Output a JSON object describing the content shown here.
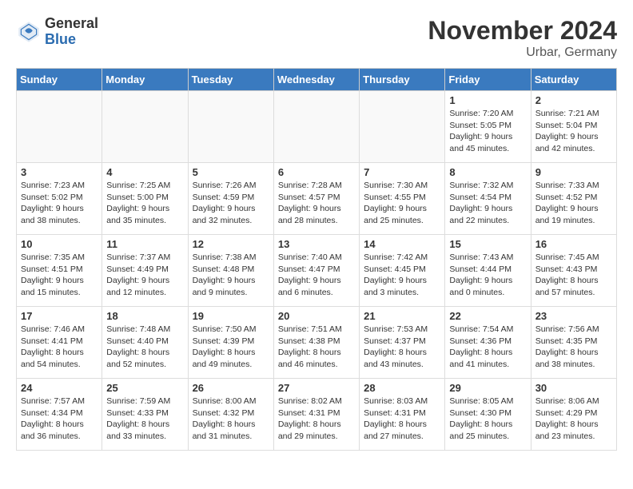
{
  "logo": {
    "general": "General",
    "blue": "Blue"
  },
  "title": "November 2024",
  "location": "Urbar, Germany",
  "days_of_week": [
    "Sunday",
    "Monday",
    "Tuesday",
    "Wednesday",
    "Thursday",
    "Friday",
    "Saturday"
  ],
  "weeks": [
    [
      {
        "day": "",
        "info": "",
        "empty": true
      },
      {
        "day": "",
        "info": "",
        "empty": true
      },
      {
        "day": "",
        "info": "",
        "empty": true
      },
      {
        "day": "",
        "info": "",
        "empty": true
      },
      {
        "day": "",
        "info": "",
        "empty": true
      },
      {
        "day": "1",
        "info": "Sunrise: 7:20 AM\nSunset: 5:05 PM\nDaylight: 9 hours and 45 minutes."
      },
      {
        "day": "2",
        "info": "Sunrise: 7:21 AM\nSunset: 5:04 PM\nDaylight: 9 hours and 42 minutes."
      }
    ],
    [
      {
        "day": "3",
        "info": "Sunrise: 7:23 AM\nSunset: 5:02 PM\nDaylight: 9 hours and 38 minutes."
      },
      {
        "day": "4",
        "info": "Sunrise: 7:25 AM\nSunset: 5:00 PM\nDaylight: 9 hours and 35 minutes."
      },
      {
        "day": "5",
        "info": "Sunrise: 7:26 AM\nSunset: 4:59 PM\nDaylight: 9 hours and 32 minutes."
      },
      {
        "day": "6",
        "info": "Sunrise: 7:28 AM\nSunset: 4:57 PM\nDaylight: 9 hours and 28 minutes."
      },
      {
        "day": "7",
        "info": "Sunrise: 7:30 AM\nSunset: 4:55 PM\nDaylight: 9 hours and 25 minutes."
      },
      {
        "day": "8",
        "info": "Sunrise: 7:32 AM\nSunset: 4:54 PM\nDaylight: 9 hours and 22 minutes."
      },
      {
        "day": "9",
        "info": "Sunrise: 7:33 AM\nSunset: 4:52 PM\nDaylight: 9 hours and 19 minutes."
      }
    ],
    [
      {
        "day": "10",
        "info": "Sunrise: 7:35 AM\nSunset: 4:51 PM\nDaylight: 9 hours and 15 minutes."
      },
      {
        "day": "11",
        "info": "Sunrise: 7:37 AM\nSunset: 4:49 PM\nDaylight: 9 hours and 12 minutes."
      },
      {
        "day": "12",
        "info": "Sunrise: 7:38 AM\nSunset: 4:48 PM\nDaylight: 9 hours and 9 minutes."
      },
      {
        "day": "13",
        "info": "Sunrise: 7:40 AM\nSunset: 4:47 PM\nDaylight: 9 hours and 6 minutes."
      },
      {
        "day": "14",
        "info": "Sunrise: 7:42 AM\nSunset: 4:45 PM\nDaylight: 9 hours and 3 minutes."
      },
      {
        "day": "15",
        "info": "Sunrise: 7:43 AM\nSunset: 4:44 PM\nDaylight: 9 hours and 0 minutes."
      },
      {
        "day": "16",
        "info": "Sunrise: 7:45 AM\nSunset: 4:43 PM\nDaylight: 8 hours and 57 minutes."
      }
    ],
    [
      {
        "day": "17",
        "info": "Sunrise: 7:46 AM\nSunset: 4:41 PM\nDaylight: 8 hours and 54 minutes."
      },
      {
        "day": "18",
        "info": "Sunrise: 7:48 AM\nSunset: 4:40 PM\nDaylight: 8 hours and 52 minutes."
      },
      {
        "day": "19",
        "info": "Sunrise: 7:50 AM\nSunset: 4:39 PM\nDaylight: 8 hours and 49 minutes."
      },
      {
        "day": "20",
        "info": "Sunrise: 7:51 AM\nSunset: 4:38 PM\nDaylight: 8 hours and 46 minutes."
      },
      {
        "day": "21",
        "info": "Sunrise: 7:53 AM\nSunset: 4:37 PM\nDaylight: 8 hours and 43 minutes."
      },
      {
        "day": "22",
        "info": "Sunrise: 7:54 AM\nSunset: 4:36 PM\nDaylight: 8 hours and 41 minutes."
      },
      {
        "day": "23",
        "info": "Sunrise: 7:56 AM\nSunset: 4:35 PM\nDaylight: 8 hours and 38 minutes."
      }
    ],
    [
      {
        "day": "24",
        "info": "Sunrise: 7:57 AM\nSunset: 4:34 PM\nDaylight: 8 hours and 36 minutes."
      },
      {
        "day": "25",
        "info": "Sunrise: 7:59 AM\nSunset: 4:33 PM\nDaylight: 8 hours and 33 minutes."
      },
      {
        "day": "26",
        "info": "Sunrise: 8:00 AM\nSunset: 4:32 PM\nDaylight: 8 hours and 31 minutes."
      },
      {
        "day": "27",
        "info": "Sunrise: 8:02 AM\nSunset: 4:31 PM\nDaylight: 8 hours and 29 minutes."
      },
      {
        "day": "28",
        "info": "Sunrise: 8:03 AM\nSunset: 4:31 PM\nDaylight: 8 hours and 27 minutes."
      },
      {
        "day": "29",
        "info": "Sunrise: 8:05 AM\nSunset: 4:30 PM\nDaylight: 8 hours and 25 minutes."
      },
      {
        "day": "30",
        "info": "Sunrise: 8:06 AM\nSunset: 4:29 PM\nDaylight: 8 hours and 23 minutes."
      }
    ]
  ]
}
